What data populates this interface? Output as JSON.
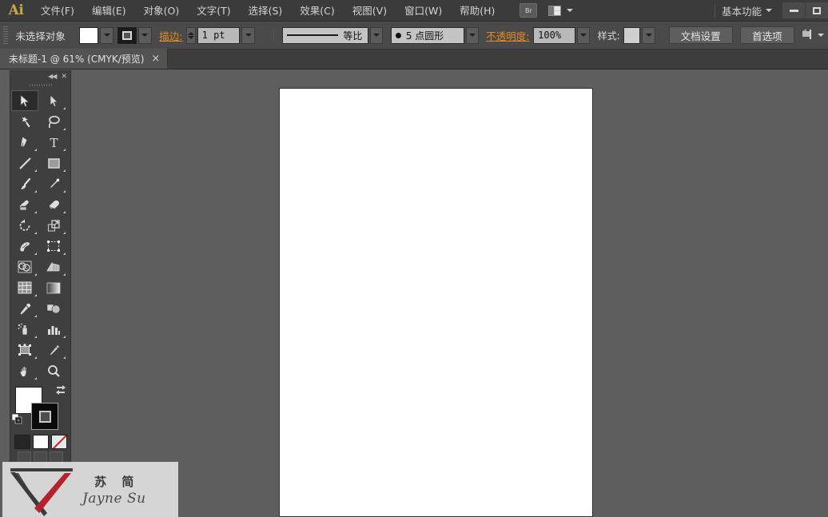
{
  "app": {
    "name": "Ai",
    "logo_color": "#c8a84a"
  },
  "menubar": {
    "items": [
      {
        "label": "文件(F)",
        "name": "menu-file"
      },
      {
        "label": "编辑(E)",
        "name": "menu-edit"
      },
      {
        "label": "对象(O)",
        "name": "menu-object"
      },
      {
        "label": "文字(T)",
        "name": "menu-type"
      },
      {
        "label": "选择(S)",
        "name": "menu-select"
      },
      {
        "label": "效果(C)",
        "name": "menu-effect"
      },
      {
        "label": "视图(V)",
        "name": "menu-view"
      },
      {
        "label": "窗口(W)",
        "name": "menu-window"
      },
      {
        "label": "帮助(H)",
        "name": "menu-help"
      }
    ],
    "bridge_label": "Br",
    "workspace_label": "基本功能"
  },
  "controlbar": {
    "selection_status": "未选择对象",
    "fill_color": "#ffffff",
    "stroke_label": "描边:",
    "stroke_weight": "1 pt",
    "profile_label": "等比",
    "brush_label": "5 点圆形",
    "opacity_label": "不透明度:",
    "opacity_value": "100%",
    "style_label": "样式:",
    "document_setup": "文档设置",
    "preferences": "首选项"
  },
  "tabbar": {
    "tab_title": "未标题-1 @ 61% (CMYK/预览)",
    "close_glyph": "×"
  },
  "toolpanel": {
    "collapse_glyph": "◀◀",
    "close_glyph": "✕",
    "tools": [
      {
        "name": "tool-selection",
        "label": "选择工具",
        "active": true
      },
      {
        "name": "tool-direct-selection",
        "label": "直接选择工具",
        "active": false
      },
      {
        "name": "tool-magic-wand",
        "label": "魔棒工具",
        "active": false
      },
      {
        "name": "tool-lasso",
        "label": "套索工具",
        "active": false
      },
      {
        "name": "tool-pen",
        "label": "钢笔工具",
        "active": false
      },
      {
        "name": "tool-type",
        "label": "文字工具",
        "active": false
      },
      {
        "name": "tool-line-segment",
        "label": "直线段工具",
        "active": false
      },
      {
        "name": "tool-rectangle",
        "label": "矩形工具",
        "active": false
      },
      {
        "name": "tool-paintbrush",
        "label": "画笔工具",
        "active": false
      },
      {
        "name": "tool-pencil",
        "label": "铅笔工具",
        "active": false
      },
      {
        "name": "tool-blob-brush",
        "label": "斑点画笔工具",
        "active": false
      },
      {
        "name": "tool-eraser",
        "label": "橡皮擦工具",
        "active": false
      },
      {
        "name": "tool-rotate",
        "label": "旋转工具",
        "active": false
      },
      {
        "name": "tool-scale",
        "label": "比例缩放工具",
        "active": false
      },
      {
        "name": "tool-warp",
        "label": "变形工具",
        "active": false
      },
      {
        "name": "tool-free-transform",
        "label": "自由变换工具",
        "active": false
      },
      {
        "name": "tool-shape-builder",
        "label": "形状生成器工具",
        "active": false
      },
      {
        "name": "tool-perspective-grid",
        "label": "透视网格工具",
        "active": false
      },
      {
        "name": "tool-mesh",
        "label": "网格工具",
        "active": false
      },
      {
        "name": "tool-gradient",
        "label": "渐变工具",
        "active": false
      },
      {
        "name": "tool-eyedropper",
        "label": "吸管工具",
        "active": false
      },
      {
        "name": "tool-blend",
        "label": "混合工具",
        "active": false
      },
      {
        "name": "tool-symbol-sprayer",
        "label": "符号喷枪工具",
        "active": false
      },
      {
        "name": "tool-column-graph",
        "label": "柱形图工具",
        "active": false
      },
      {
        "name": "tool-artboard",
        "label": "画板工具",
        "active": false
      },
      {
        "name": "tool-slice",
        "label": "切片工具",
        "active": false
      },
      {
        "name": "tool-hand",
        "label": "抓手工具",
        "active": false
      },
      {
        "name": "tool-zoom",
        "label": "缩放工具",
        "active": false
      }
    ],
    "fill_color": "#ffffff",
    "stroke_color": "#000000",
    "color_buttons": [
      {
        "name": "color-button",
        "label": "颜色"
      },
      {
        "name": "gradient-button",
        "label": "渐变"
      },
      {
        "name": "none-button",
        "label": "无"
      }
    ]
  },
  "workspace": {
    "canvas_bg": "#5e5e5e",
    "artboard_bg": "#ffffff",
    "zoom_level": "61%"
  },
  "watermark": {
    "cn_name": "苏 简",
    "en_name": "Jayne Su"
  }
}
